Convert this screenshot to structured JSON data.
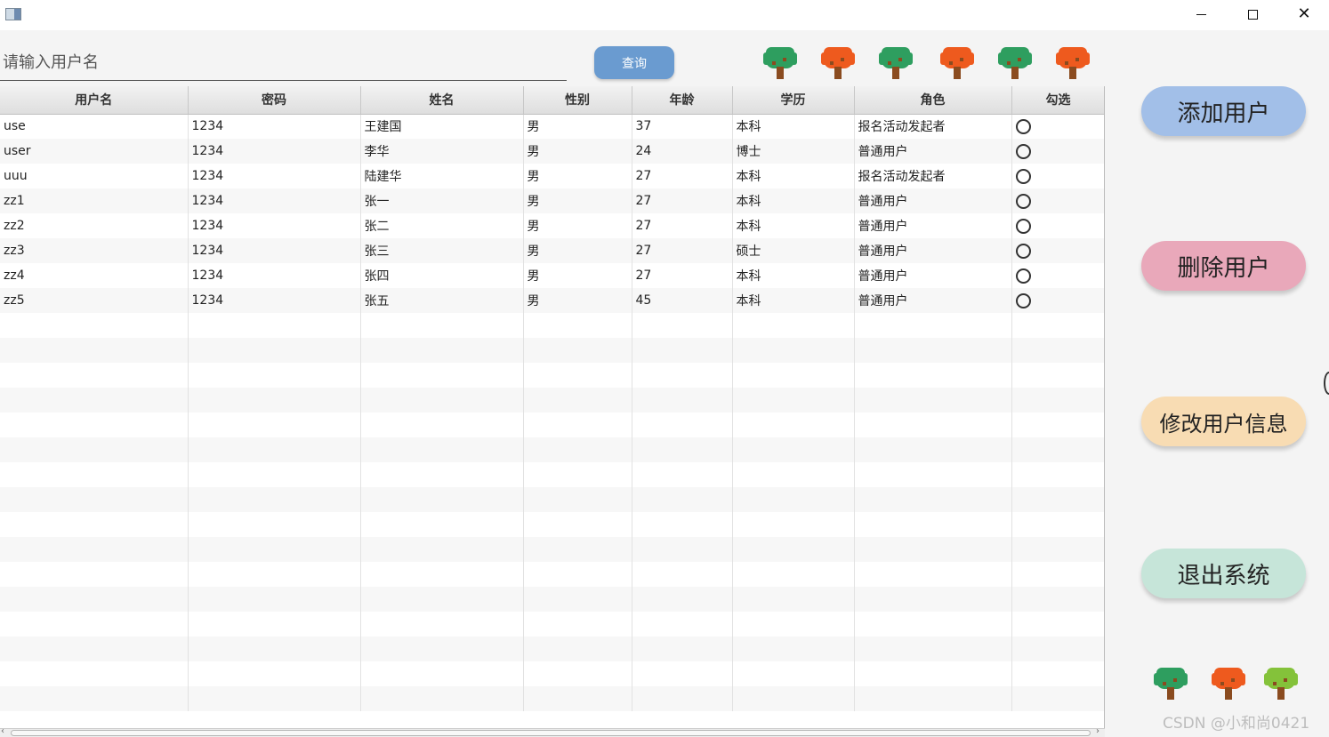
{
  "window": {
    "minimize_icon": "minimize-icon",
    "maximize_icon": "maximize-icon",
    "close_icon": "close-icon"
  },
  "search": {
    "placeholder": "请输入用户名",
    "value": "",
    "button_label": "查询"
  },
  "table": {
    "columns": [
      "用户名",
      "密码",
      "姓名",
      "性别",
      "年龄",
      "学历",
      "角色",
      "勾选"
    ],
    "rows": [
      [
        "use",
        "1234",
        "王建国",
        "男",
        "37",
        "本科",
        "报名活动发起者"
      ],
      [
        "user",
        "1234",
        "李华",
        "男",
        "24",
        "博士",
        "普通用户"
      ],
      [
        "uuu",
        "1234",
        "陆建华",
        "男",
        "27",
        "本科",
        "报名活动发起者"
      ],
      [
        "zz1",
        "1234",
        "张一",
        "男",
        "27",
        "本科",
        "普通用户"
      ],
      [
        "zz2",
        "1234",
        "张二",
        "男",
        "27",
        "本科",
        "普通用户"
      ],
      [
        "zz3",
        "1234",
        "张三",
        "男",
        "27",
        "硕士",
        "普通用户"
      ],
      [
        "zz4",
        "1234",
        "张四",
        "男",
        "27",
        "本科",
        "普通用户"
      ],
      [
        "zz5",
        "1234",
        "张五",
        "男",
        "45",
        "本科",
        "普通用户"
      ]
    ]
  },
  "actions": {
    "add_label": "添加用户",
    "delete_label": "删除用户",
    "edit_label": "修改用户信息",
    "exit_label": "退出系统"
  },
  "decor": {
    "top_trees": [
      "green",
      "orange",
      "green",
      "orange",
      "green",
      "orange"
    ],
    "bottom_trees": [
      "green",
      "orange",
      "lime"
    ],
    "colors": {
      "green": "#2e9e5f",
      "orange": "#ee5a1e",
      "lime": "#84c23a",
      "query_button": "#6a9bd0"
    }
  },
  "watermark": "CSDN @小和尚0421"
}
